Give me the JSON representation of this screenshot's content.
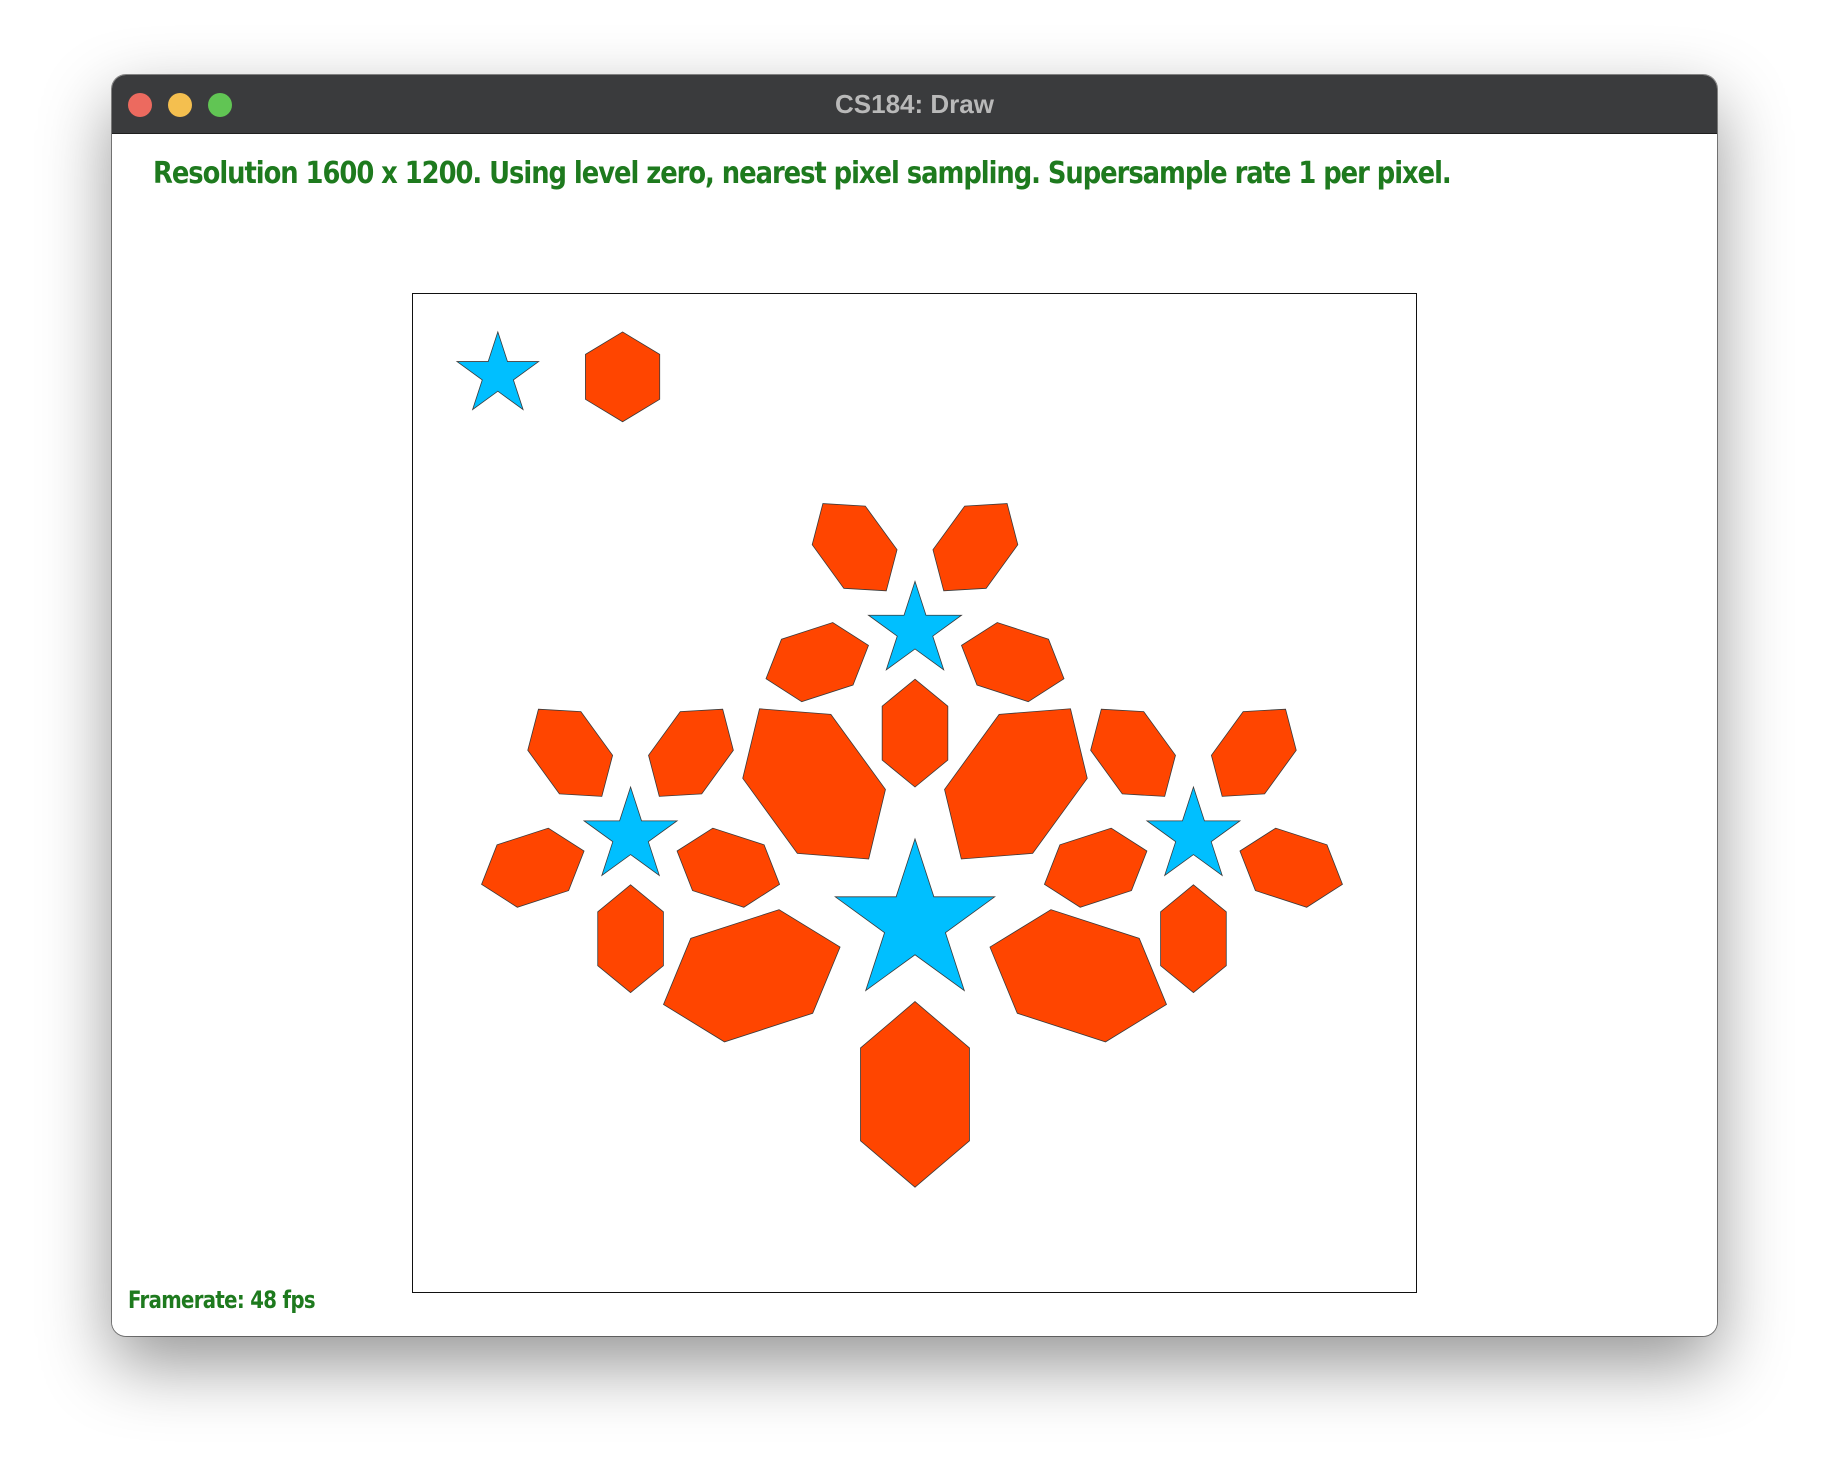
{
  "window": {
    "title": "CS184: Draw"
  },
  "status": {
    "text": "Resolution 1600 x 1200. Using level zero, nearest pixel sampling. Supersample rate 1 per pixel."
  },
  "framerate": {
    "text": "Framerate: 48 fps"
  },
  "colors": {
    "star": "#00bfff",
    "hexagon": "#ff4500",
    "outline": "#3a3a3a",
    "status_text": "#1e7a1e",
    "titlebar": "#3a3b3d"
  },
  "icons": {
    "close": "close-window-icon",
    "minimize": "minimize-window-icon",
    "zoom": "zoom-window-icon"
  }
}
